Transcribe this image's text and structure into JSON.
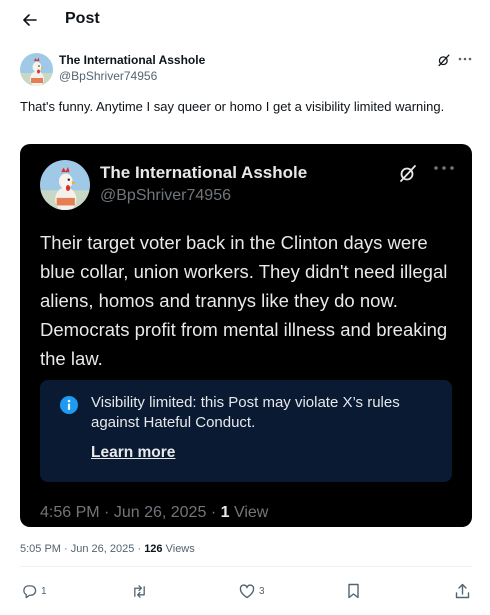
{
  "header": {
    "title": "Post"
  },
  "post": {
    "author_name": "The International Asshole",
    "author_handle": "@BpShriver74956",
    "text": "That's funny. Anytime I say queer or homo I get a visibility limited warning.",
    "time": "5:05 PM",
    "date": "Jun 26, 2025",
    "views_count": "126",
    "views_label": "Views",
    "separator": "·"
  },
  "quote": {
    "author_name": "The International Asshole",
    "author_handle": "@BpShriver74956",
    "text": "Their target voter back in the Clinton days were blue collar, union workers. They didn't need illegal aliens, homos and trannys like they do now. Democrats profit from mental illness and breaking the law.",
    "visibility_notice": "Visibility limited: this Post may violate X’s rules against Hateful Conduct.",
    "learn_more": "Learn more",
    "time": "4:56 PM",
    "date": "Jun 26, 2025",
    "views_count": "1",
    "views_label": "View",
    "separator": "·"
  },
  "actions": {
    "replies": "1",
    "reposts": "",
    "likes": "3"
  },
  "colors": {
    "text_primary": "#0f1419",
    "text_secondary": "#536471",
    "quote_background": "#000000",
    "notice_background": "#0a1a33",
    "info_icon": "#1d9bf0"
  },
  "icons": {
    "back": "arrow-left-icon",
    "grok": "grok-icon",
    "more": "more-horizontal-icon",
    "info": "info-icon",
    "reply": "reply-icon",
    "repost": "repost-icon",
    "like": "like-icon",
    "bookmark": "bookmark-icon",
    "share": "share-icon"
  }
}
